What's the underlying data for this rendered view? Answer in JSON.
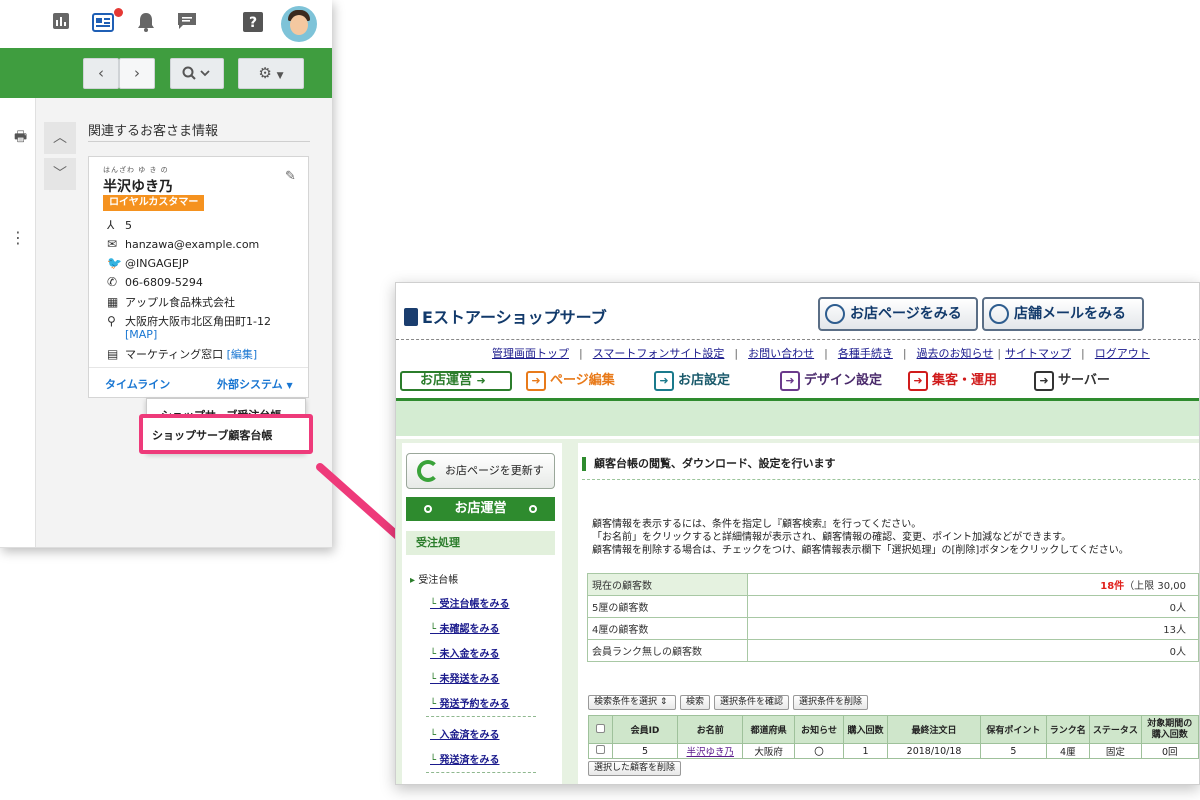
{
  "crm": {
    "related_title": "関連するお客さま情報",
    "customer": {
      "ruby": "はんざわ ゆ き の",
      "name": "半沢ゆき乃",
      "rank": "ロイヤルカスタマー",
      "count": "5",
      "email": "hanzawa@example.com",
      "twitter": "@INGAGEJP",
      "phone": "06-6809-5294",
      "company": "アップル食品株式会社",
      "address": "大阪府大阪市北区角田町1-12",
      "map_link": "[MAP]",
      "department": "マーケティング窓口",
      "edit_link": "[編集]"
    },
    "timeline": "タイムライン",
    "external_system": "外部システム",
    "dropdown_items": [
      "ショップサーブ受注台帳",
      "ショップサーブ顧客台帳"
    ]
  },
  "shop": {
    "logo": "Eストアーショップサーブ",
    "header_buttons": [
      "お店ページをみる",
      "店舗メールをみる"
    ],
    "nav_links": [
      "管理画面トップ",
      "スマートフォンサイト設定",
      "お問い合わせ",
      "各種手続き",
      "過去のお知らせ",
      "サイトマップ",
      "ログアウト"
    ],
    "tabs": [
      {
        "label": "お店運営",
        "color": "#2b7d2b"
      },
      {
        "label": "ページ編集",
        "color": "#e87a1a"
      },
      {
        "label": "お店設定",
        "color": "#1a7a8c"
      },
      {
        "label": "デザイン設定",
        "color": "#6b3a8c"
      },
      {
        "label": "集客・運用",
        "color": "#d01c1c"
      },
      {
        "label": "サーバー",
        "color": "#333333"
      }
    ],
    "sidebar": {
      "refresh": "お店ページを更新する",
      "operations": "お店運営",
      "section": "受注処理",
      "head": "受注台帳",
      "items": [
        "受注台帳をみる",
        "未確認をみる",
        "未入金をみる",
        "未発送をみる",
        "発送予約をみる",
        "入金済をみる",
        "発送済をみる"
      ]
    },
    "main_title": "顧客台帳の閲覧、ダウンロード、設定を行います",
    "description": [
      "顧客情報を表示するには、条件を指定し『顧客検索』を行ってください。",
      "「お名前」をクリックすると詳細情報が表示され、顧客情報の確認、変更、ポイント加減などができます。",
      "顧客情報を削除する場合は、チェックをつけ、顧客情報表示欄下「選択処理」の[削除]ボタンをクリックしてください。"
    ],
    "summary": [
      {
        "label": "現在の顧客数",
        "value": "18件",
        "note": "（上限 30,00"
      },
      {
        "label": "5厘の顧客数",
        "value": "0人"
      },
      {
        "label": "4厘の顧客数",
        "value": "13人"
      },
      {
        "label": "会員ランク無しの顧客数",
        "value": "0人"
      }
    ],
    "controls": {
      "select_label": "検索条件を選択",
      "search": "検索",
      "confirm": "選択条件を確認",
      "delete_cond": "選択条件を削除",
      "delete_selected": "選択した顧客を削除"
    },
    "table": {
      "headers": [
        "会員ID",
        "お名前",
        "都道府県",
        "お知らせ",
        "購入回数",
        "最終注文日",
        "保有ポイント",
        "ランク名",
        "ステータス",
        "対象期間の\n購入回数"
      ],
      "row": [
        "5",
        "半沢ゆき乃",
        "大阪府",
        "〇",
        "1",
        "2018/10/18",
        "5",
        "4厘",
        "固定",
        "0回"
      ]
    }
  }
}
